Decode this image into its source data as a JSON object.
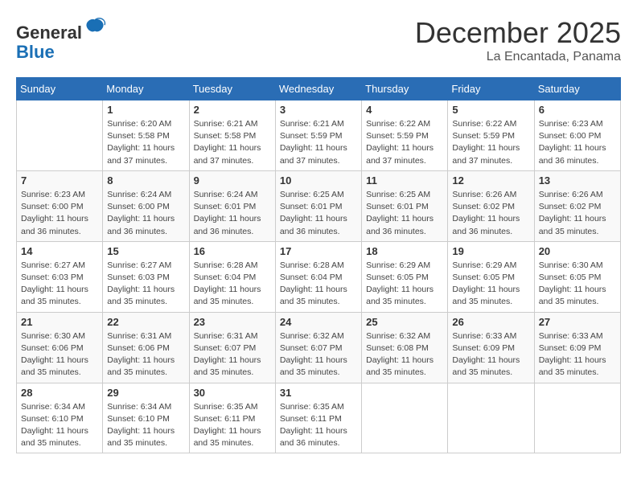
{
  "header": {
    "logo_line1": "General",
    "logo_line2": "Blue",
    "month_title": "December 2025",
    "location": "La Encantada, Panama"
  },
  "days_of_week": [
    "Sunday",
    "Monday",
    "Tuesday",
    "Wednesday",
    "Thursday",
    "Friday",
    "Saturday"
  ],
  "weeks": [
    [
      {
        "day": "",
        "info": ""
      },
      {
        "day": "1",
        "info": "Sunrise: 6:20 AM\nSunset: 5:58 PM\nDaylight: 11 hours\nand 37 minutes."
      },
      {
        "day": "2",
        "info": "Sunrise: 6:21 AM\nSunset: 5:58 PM\nDaylight: 11 hours\nand 37 minutes."
      },
      {
        "day": "3",
        "info": "Sunrise: 6:21 AM\nSunset: 5:59 PM\nDaylight: 11 hours\nand 37 minutes."
      },
      {
        "day": "4",
        "info": "Sunrise: 6:22 AM\nSunset: 5:59 PM\nDaylight: 11 hours\nand 37 minutes."
      },
      {
        "day": "5",
        "info": "Sunrise: 6:22 AM\nSunset: 5:59 PM\nDaylight: 11 hours\nand 37 minutes."
      },
      {
        "day": "6",
        "info": "Sunrise: 6:23 AM\nSunset: 6:00 PM\nDaylight: 11 hours\nand 36 minutes."
      }
    ],
    [
      {
        "day": "7",
        "info": "Sunrise: 6:23 AM\nSunset: 6:00 PM\nDaylight: 11 hours\nand 36 minutes."
      },
      {
        "day": "8",
        "info": "Sunrise: 6:24 AM\nSunset: 6:00 PM\nDaylight: 11 hours\nand 36 minutes."
      },
      {
        "day": "9",
        "info": "Sunrise: 6:24 AM\nSunset: 6:01 PM\nDaylight: 11 hours\nand 36 minutes."
      },
      {
        "day": "10",
        "info": "Sunrise: 6:25 AM\nSunset: 6:01 PM\nDaylight: 11 hours\nand 36 minutes."
      },
      {
        "day": "11",
        "info": "Sunrise: 6:25 AM\nSunset: 6:01 PM\nDaylight: 11 hours\nand 36 minutes."
      },
      {
        "day": "12",
        "info": "Sunrise: 6:26 AM\nSunset: 6:02 PM\nDaylight: 11 hours\nand 36 minutes."
      },
      {
        "day": "13",
        "info": "Sunrise: 6:26 AM\nSunset: 6:02 PM\nDaylight: 11 hours\nand 35 minutes."
      }
    ],
    [
      {
        "day": "14",
        "info": "Sunrise: 6:27 AM\nSunset: 6:03 PM\nDaylight: 11 hours\nand 35 minutes."
      },
      {
        "day": "15",
        "info": "Sunrise: 6:27 AM\nSunset: 6:03 PM\nDaylight: 11 hours\nand 35 minutes."
      },
      {
        "day": "16",
        "info": "Sunrise: 6:28 AM\nSunset: 6:04 PM\nDaylight: 11 hours\nand 35 minutes."
      },
      {
        "day": "17",
        "info": "Sunrise: 6:28 AM\nSunset: 6:04 PM\nDaylight: 11 hours\nand 35 minutes."
      },
      {
        "day": "18",
        "info": "Sunrise: 6:29 AM\nSunset: 6:05 PM\nDaylight: 11 hours\nand 35 minutes."
      },
      {
        "day": "19",
        "info": "Sunrise: 6:29 AM\nSunset: 6:05 PM\nDaylight: 11 hours\nand 35 minutes."
      },
      {
        "day": "20",
        "info": "Sunrise: 6:30 AM\nSunset: 6:05 PM\nDaylight: 11 hours\nand 35 minutes."
      }
    ],
    [
      {
        "day": "21",
        "info": "Sunrise: 6:30 AM\nSunset: 6:06 PM\nDaylight: 11 hours\nand 35 minutes."
      },
      {
        "day": "22",
        "info": "Sunrise: 6:31 AM\nSunset: 6:06 PM\nDaylight: 11 hours\nand 35 minutes."
      },
      {
        "day": "23",
        "info": "Sunrise: 6:31 AM\nSunset: 6:07 PM\nDaylight: 11 hours\nand 35 minutes."
      },
      {
        "day": "24",
        "info": "Sunrise: 6:32 AM\nSunset: 6:07 PM\nDaylight: 11 hours\nand 35 minutes."
      },
      {
        "day": "25",
        "info": "Sunrise: 6:32 AM\nSunset: 6:08 PM\nDaylight: 11 hours\nand 35 minutes."
      },
      {
        "day": "26",
        "info": "Sunrise: 6:33 AM\nSunset: 6:09 PM\nDaylight: 11 hours\nand 35 minutes."
      },
      {
        "day": "27",
        "info": "Sunrise: 6:33 AM\nSunset: 6:09 PM\nDaylight: 11 hours\nand 35 minutes."
      }
    ],
    [
      {
        "day": "28",
        "info": "Sunrise: 6:34 AM\nSunset: 6:10 PM\nDaylight: 11 hours\nand 35 minutes."
      },
      {
        "day": "29",
        "info": "Sunrise: 6:34 AM\nSunset: 6:10 PM\nDaylight: 11 hours\nand 35 minutes."
      },
      {
        "day": "30",
        "info": "Sunrise: 6:35 AM\nSunset: 6:11 PM\nDaylight: 11 hours\nand 35 minutes."
      },
      {
        "day": "31",
        "info": "Sunrise: 6:35 AM\nSunset: 6:11 PM\nDaylight: 11 hours\nand 36 minutes."
      },
      {
        "day": "",
        "info": ""
      },
      {
        "day": "",
        "info": ""
      },
      {
        "day": "",
        "info": ""
      }
    ]
  ]
}
